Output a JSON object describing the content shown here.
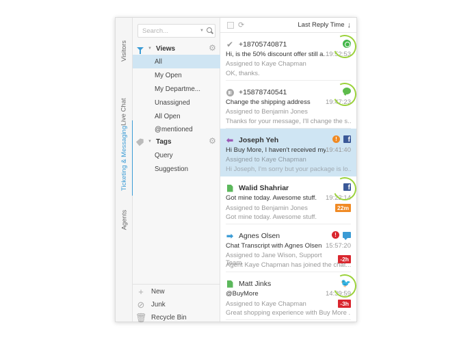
{
  "tabs": [
    {
      "label": "Visitors",
      "active": false
    },
    {
      "label": "Live Chat",
      "active": false
    },
    {
      "label": "Ticketing & Messaging",
      "active": true
    },
    {
      "label": "Agents",
      "active": false
    }
  ],
  "search": {
    "placeholder": "Search..."
  },
  "views": {
    "title": "Views",
    "items": [
      "All",
      "My Open",
      "My Departme...",
      "Unassigned",
      "All Open",
      "@mentioned"
    ],
    "active_index": 0
  },
  "tags": {
    "title": "Tags",
    "items": [
      "Query",
      "Suggestion"
    ]
  },
  "bottom_actions": [
    {
      "label": "New",
      "icon": "plus-icon"
    },
    {
      "label": "Junk",
      "icon": "block-icon"
    },
    {
      "label": "Recycle Bin",
      "icon": "trash-icon"
    }
  ],
  "list_header": {
    "sort_label": "Last Reply Time",
    "sort_direction": "descending"
  },
  "conversations": [
    {
      "status_icon": "check-icon",
      "name": "+18705740871",
      "subject": "Hi, is the 50% discount offer still a...",
      "time": "19:52:53",
      "assigned": "Assigned to Kaye Chapman",
      "preview": "OK, thanks.",
      "channel_icon": "whatsapp-icon",
      "highlighted": true
    },
    {
      "status_icon": "pause-icon",
      "name": "+15878740541",
      "subject": "Change the shipping address",
      "time": "19:47:23",
      "assigned": "Assigned to Benjamin Jones",
      "preview": "Thanks for your message, I'll change the s...",
      "channel_icon": "sms-icon",
      "highlighted": true
    },
    {
      "status_icon": "reply-arrow-icon",
      "name": "Joseph Yeh",
      "subject": "Hi Buy More, I haven't received my...",
      "time": "19:41:40",
      "assigned": "Assigned to Kaye Chapman",
      "preview": "Hi Joseph, I'm sorry but your package is lo...",
      "channel_icon": "facebook-icon",
      "priority": "!",
      "priority_color": "#f08a24",
      "selected": true
    },
    {
      "status_icon": "document-icon",
      "name": "Walid Shahriar",
      "subject": "Got mine today. Awesome stuff.",
      "time": "19:22:14",
      "assigned": "Assigned to Benjamin Jones",
      "preview": "Got mine today. Awesome stuff.",
      "channel_icon": "facebook-icon",
      "badge": "22m",
      "badge_color": "#f08a24",
      "highlighted": true
    },
    {
      "status_icon": "forward-arrow-icon",
      "name": "Agnes Olsen",
      "subject": "Chat Transcript with Agnes Olsen",
      "time": "15:57:20",
      "assigned": "Assigned to Jane Wison, Support Team",
      "preview": "Agent Kaye Chapman has joined the chat....",
      "channel_icon": "chat-icon",
      "priority": "!",
      "priority_color": "#d9262e",
      "badge": "-2h",
      "badge_color": "#d9262e"
    },
    {
      "status_icon": "document-icon",
      "name": "Matt Jinks",
      "subject": "@BuyMore",
      "time": "14:39:59",
      "assigned": "Assigned to Kaye Chapman",
      "preview": "Great shopping experience with Buy More ...",
      "channel_icon": "twitter-icon",
      "badge": "-3h",
      "badge_color": "#d9262e",
      "highlighted": true
    }
  ],
  "colors": {
    "accent": "#3a9bd5",
    "selected_bg": "#cfe5f3",
    "highlight_ring": "#9bd23a",
    "facebook": "#3b5998",
    "whatsapp": "#43b649",
    "twitter": "#3aaee6"
  }
}
